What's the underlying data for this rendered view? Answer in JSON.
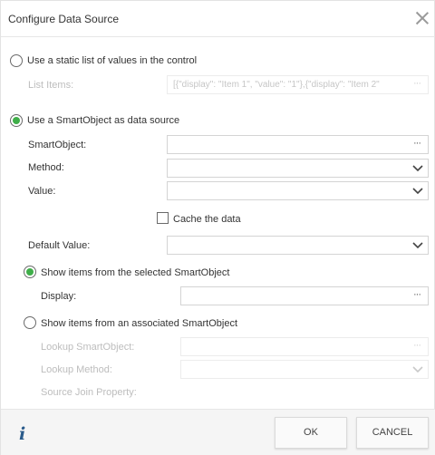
{
  "dialog": {
    "title": "Configure Data Source"
  },
  "static_option": {
    "label": "Use a static list of values in the control",
    "selected": false,
    "list_items_label": "List Items:",
    "list_items_value": "[{\"display\": \"Item 1\", \"value\": \"1\"},{\"display\": \"Item 2\"",
    "list_items_dots": "···"
  },
  "smartobject_option": {
    "label": "Use a SmartObject as data source",
    "selected": true,
    "smartobject_label": "SmartObject:",
    "smartobject_value": "",
    "smartobject_dots": "···",
    "method_label": "Method:",
    "method_value": "",
    "value_label": "Value:",
    "value_value": "",
    "cache_label": "Cache the data",
    "cache_checked": false,
    "default_value_label": "Default Value:",
    "default_value": ""
  },
  "selected_items_option": {
    "label": "Show items from the selected SmartObject",
    "selected": true,
    "display_label": "Display:",
    "display_value": "",
    "display_dots": "···"
  },
  "associated_option": {
    "label": "Show items from an associated SmartObject",
    "selected": false,
    "lookup_smartobject_label": "Lookup SmartObject:",
    "lookup_smartobject_dots": "···",
    "lookup_method_label": "Lookup Method:",
    "source_join_label": "Source Join Property:"
  },
  "footer": {
    "info_icon": "i",
    "ok_label": "OK",
    "cancel_label": "CANCEL"
  },
  "colors": {
    "radio_selected": "#3fae49",
    "info_icon": "#2a5b8b"
  }
}
